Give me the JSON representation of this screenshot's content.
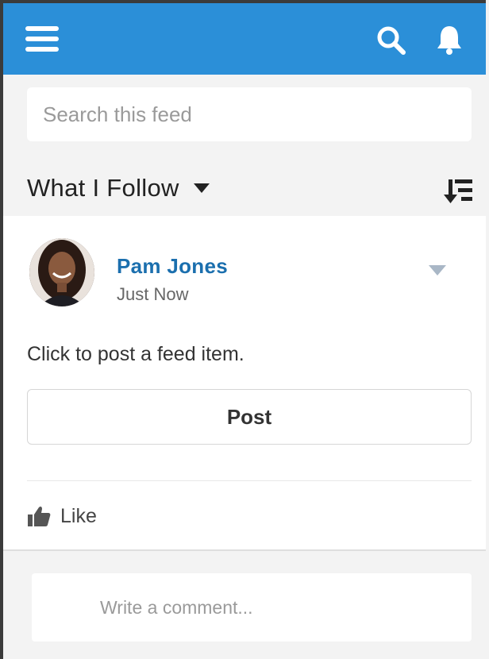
{
  "header": {
    "menu_icon": "hamburger-menu-icon",
    "search_icon": "search-icon",
    "notifications_icon": "bell-icon",
    "background_color": "#2b8fd8"
  },
  "search": {
    "placeholder": "Search this feed"
  },
  "feed_filter": {
    "title": "What I Follow",
    "dropdown_icon": "caret-down-icon",
    "sort_icon": "sort-icon"
  },
  "feed_item": {
    "author": "Pam Jones",
    "timestamp": "Just Now",
    "body": "Click to post a feed item.",
    "action_button": "Post",
    "like_label": "Like",
    "author_color": "#1b6fae"
  },
  "comment": {
    "placeholder": "Write a comment..."
  }
}
